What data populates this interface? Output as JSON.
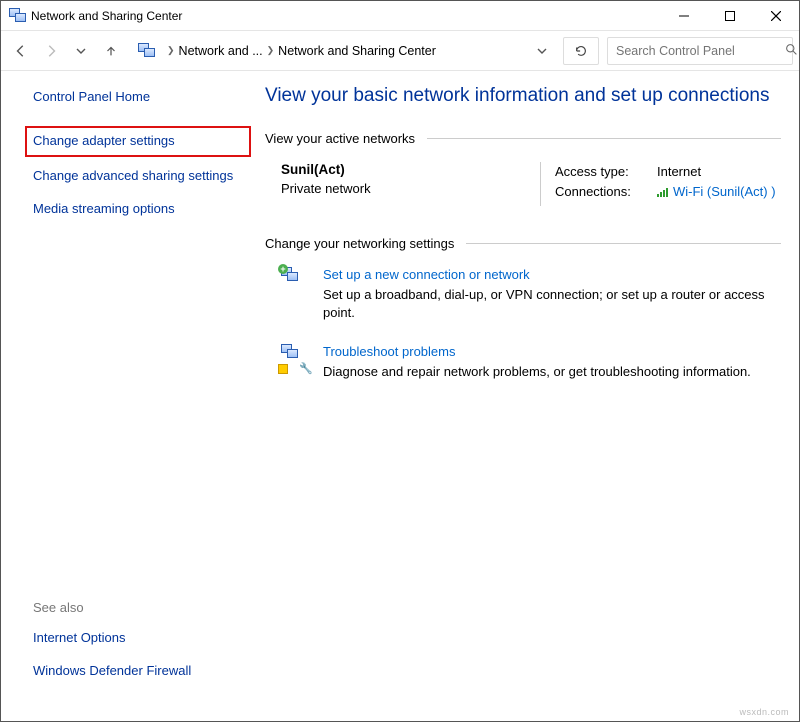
{
  "window": {
    "title": "Network and Sharing Center"
  },
  "nav": {
    "breadcrumbs": [
      "Network and ...",
      "Network and Sharing Center"
    ],
    "search_placeholder": "Search Control Panel"
  },
  "sidebar": {
    "home": "Control Panel Home",
    "items": [
      "Change adapter settings",
      "Change advanced sharing settings",
      "Media streaming options"
    ],
    "highlight_index": 0,
    "see_also_label": "See also",
    "see_also": [
      "Internet Options",
      "Windows Defender Firewall"
    ]
  },
  "main": {
    "title": "View your basic network information and set up connections",
    "active_section": "View your active networks",
    "network": {
      "name": "Sunil(Act)",
      "type": "Private network",
      "access_label": "Access type:",
      "access_value": "Internet",
      "conn_label": "Connections:",
      "conn_value": "Wi-Fi (Sunil(Act) )"
    },
    "change_section": "Change your networking settings",
    "options": [
      {
        "title": "Set up a new connection or network",
        "desc": "Set up a broadband, dial-up, or VPN connection; or set up a router or access point."
      },
      {
        "title": "Troubleshoot problems",
        "desc": "Diagnose and repair network problems, or get troubleshooting information."
      }
    ]
  },
  "watermark": "wsxdn.com"
}
